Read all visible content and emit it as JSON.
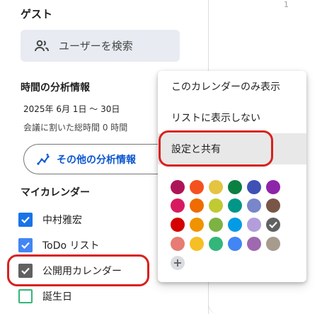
{
  "guest": {
    "title": "ゲスト",
    "search_label": "ユーザーを検索"
  },
  "analytics": {
    "title": "時間の分析情報",
    "range": "2025年 6月 1日 〜 30日",
    "total": "会議に割いた総時間 0 時間",
    "more_button": "その他の分析情報"
  },
  "my_calendars": {
    "title": "マイカレンダー",
    "items": [
      {
        "name": "中村雅宏",
        "checked": true,
        "color": "#1a73e8"
      },
      {
        "name": "ToDo リスト",
        "checked": true,
        "color": "#4285f4"
      },
      {
        "name": "公開用カレンダー",
        "checked": true,
        "color": "#616161"
      },
      {
        "name": "誕生日",
        "checked": false,
        "color": "#33b679"
      }
    ]
  },
  "menu": {
    "items": [
      {
        "label": "このカレンダーのみ表示",
        "active": false
      },
      {
        "label": "リストに表示しない",
        "active": false
      },
      {
        "label": "設定と共有",
        "active": true
      }
    ],
    "colors": [
      [
        "#ad1457",
        "#f4511e",
        "#e4c441",
        "#0b8043",
        "#3f51b5",
        "#8e24aa"
      ],
      [
        "#d81b60",
        "#ef6c00",
        "#c0ca33",
        "#009688",
        "#7986cb",
        "#795548"
      ],
      [
        "#d50000",
        "#f09300",
        "#7cb342",
        "#039be5",
        "#b39ddb",
        "#616161"
      ],
      [
        "#e67c73",
        "#f6bf26",
        "#33b679",
        "#4285f4",
        "#9e69af",
        "#a79b8e"
      ]
    ],
    "selected_color": "#616161",
    "add_symbol": "+"
  },
  "accent": {
    "highlight": "#d9211d",
    "link": "#0b57d0"
  },
  "main": {
    "edge_tick": "1"
  }
}
